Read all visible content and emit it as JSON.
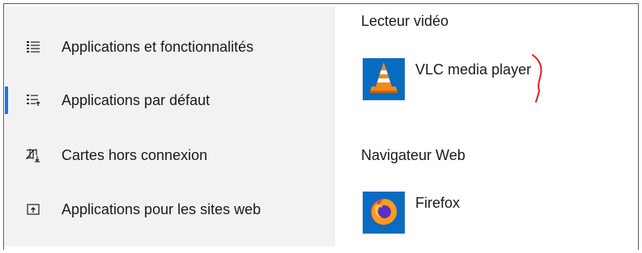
{
  "sidebar": {
    "items": [
      {
        "label": "Applications et fonctionnalités",
        "icon": "list-icon",
        "selected": false
      },
      {
        "label": "Applications par défaut",
        "icon": "default-apps-icon",
        "selected": true
      },
      {
        "label": "Cartes hors connexion",
        "icon": "map-download-icon",
        "selected": false
      },
      {
        "label": "Applications pour les sites web",
        "icon": "open-in-app-icon",
        "selected": false
      }
    ]
  },
  "main": {
    "video": {
      "heading": "Lecteur vidéo",
      "app_name": "VLC media player",
      "app_icon": "vlc-icon"
    },
    "browser": {
      "heading": "Navigateur Web",
      "app_name": "Firefox",
      "app_icon": "firefox-icon"
    }
  },
  "colors": {
    "accent": "#1a73e8",
    "tile": "#0a6bc2",
    "annotation": "#e0201c"
  }
}
